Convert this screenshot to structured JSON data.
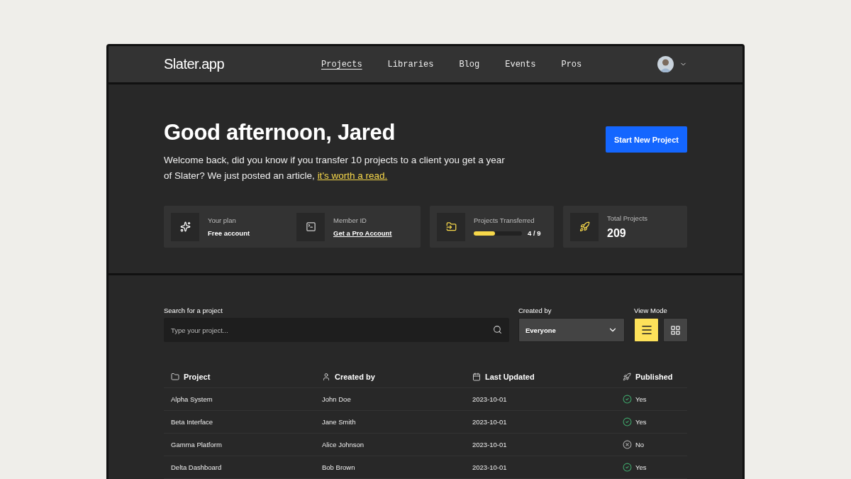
{
  "header": {
    "logo": "Slater.app",
    "nav": [
      {
        "label": "Projects",
        "selected": true
      },
      {
        "label": "Libraries",
        "selected": false
      },
      {
        "label": "Blog",
        "selected": false
      },
      {
        "label": "Events",
        "selected": false
      },
      {
        "label": "Pros",
        "selected": false
      }
    ]
  },
  "hero": {
    "title": "Good afternoon, Jared",
    "message": "Welcome back, did you know if you transfer 10 projects to a client you get a year of Slater? We just posted an article, ",
    "link": "it's worth a read.",
    "button": "Start New Project"
  },
  "stats": [
    {
      "kind": "plan",
      "label": "Your plan",
      "value": "Free account"
    },
    {
      "kind": "member",
      "label": "Member ID",
      "value": "Get a Pro Account"
    },
    {
      "kind": "progress",
      "label": "Projects Transferred",
      "level": 0.44,
      "reading": "4 / 9"
    },
    {
      "kind": "total",
      "label": "Total Projects",
      "value": "209"
    }
  ],
  "filters": {
    "search_label": "Search for a project",
    "placeholder": "Type your project...",
    "created_label": "Created by",
    "created_value": "Everyone",
    "view_label": "View Mode",
    "view_modes": [
      {
        "kind": "list",
        "selected": true
      },
      {
        "kind": "grid",
        "selected": false
      }
    ]
  },
  "table": {
    "columns": [
      {
        "kind": "folder",
        "label": "Project"
      },
      {
        "kind": "user",
        "label": "Created by"
      },
      {
        "kind": "calendar",
        "label": "Last Updated"
      },
      {
        "kind": "rocket",
        "label": "Published"
      }
    ],
    "rows": [
      {
        "project": "Alpha System",
        "created_by": "John Doe",
        "updated": "2023-10-01",
        "published": true,
        "published_label": "Yes"
      },
      {
        "project": "Beta Interface",
        "created_by": "Jane Smith",
        "updated": "2023-10-01",
        "published": true,
        "published_label": "Yes"
      },
      {
        "project": "Gamma Platform",
        "created_by": "Alice Johnson",
        "updated": "2023-10-01",
        "published": false,
        "published_label": "No"
      },
      {
        "project": "Delta Dashboard",
        "created_by": "Bob Brown",
        "updated": "2023-10-01",
        "published": true,
        "published_label": "Yes"
      }
    ]
  }
}
